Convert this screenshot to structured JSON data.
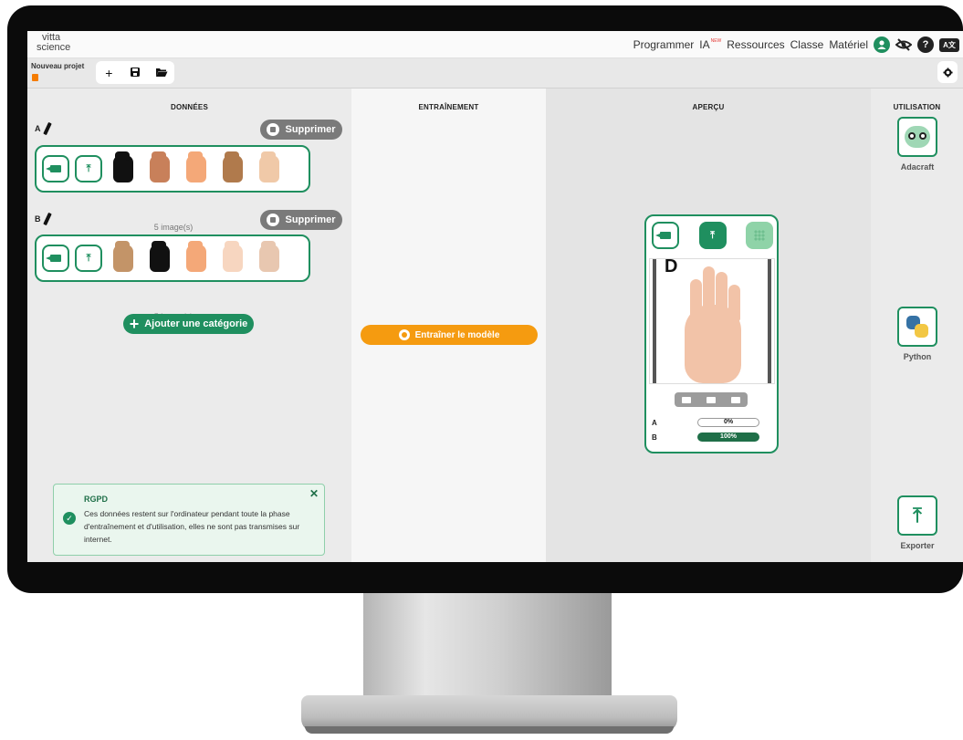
{
  "topbar": {
    "logo_line1": "vitta",
    "logo_line2": "science",
    "nav": [
      "Programmer",
      "IA",
      "Ressources",
      "Classe",
      "Matériel"
    ],
    "ia_badge": "NEW",
    "help_glyph": "?",
    "lang_label": "A文"
  },
  "toolbar": {
    "project_title": "Nouveau projet",
    "new_glyph": "+",
    "save_glyph": "▪",
    "open_glyph": "▬",
    "settings_glyph": "✱"
  },
  "columns": {
    "data": "DONNÉES",
    "training": "ENTRAÎNEMENT",
    "preview": "APERÇU",
    "use": "UTILISATION"
  },
  "categories": [
    {
      "name": "A",
      "delete_label": "Supprimer",
      "count_label": "5 image(s)",
      "thumb_colors": [
        "#111111",
        "#c8805a",
        "#f4a878",
        "#b07a4c",
        "#f0c9a8"
      ]
    },
    {
      "name": "B",
      "delete_label": "Supprimer",
      "count_label": "5 image(s)",
      "thumb_colors": [
        "#c39468",
        "#111111",
        "#f4a878",
        "#f7d6c0",
        "#e8c7b0"
      ]
    }
  ],
  "add_category_label": "Ajouter une catégorie",
  "train_label": "Entraîner le modèle",
  "gdpr": {
    "title": "RGPD",
    "text": "Ces données restent sur l'ordinateur pendant toute la phase d'entraînement et d'utilisation, elles ne sont pas transmises sur internet.",
    "close_glyph": "✕",
    "check_glyph": "✓"
  },
  "preview": {
    "letter": "D",
    "upload_glyph": "⤒",
    "results": [
      {
        "label": "A",
        "value_text": "0%",
        "value": 0
      },
      {
        "label": "B",
        "value_text": "100%",
        "value": 100
      }
    ]
  },
  "use": [
    {
      "label": "Adacraft",
      "icon": "robot-icon"
    },
    {
      "label": "Python",
      "icon": "python-icon"
    },
    {
      "label": "Exporter",
      "icon": "upload-icon"
    }
  ],
  "upload_glyph": "⤒",
  "colors": {
    "accent": "#1f8f5f",
    "train": "#f59b10",
    "delete": "#7a7a7a"
  }
}
